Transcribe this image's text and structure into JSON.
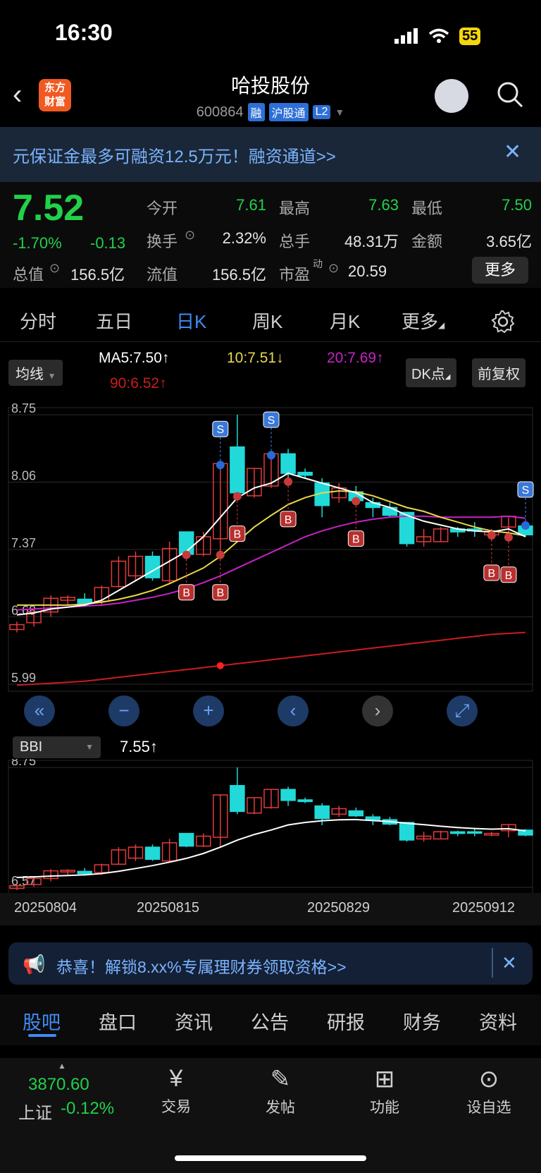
{
  "status": {
    "time": "16:30",
    "battery": "55"
  },
  "header": {
    "title": "哈投股份",
    "code": "600864",
    "tags": [
      "融",
      "沪股通",
      "L2"
    ],
    "logo": "东方财富"
  },
  "promo_top": {
    "text": "元保证金最多可融资12.5万元！融资通道>>"
  },
  "quote": {
    "price": "7.52",
    "change_pct": "-1.70%",
    "change": "-0.13",
    "open_label": "今开",
    "open": "7.61",
    "high_label": "最高",
    "high": "7.63",
    "low_label": "最低",
    "low": "7.50",
    "turnover_label": "换手",
    "turnover": "2.32%",
    "volume_label": "总手",
    "volume": "48.31万",
    "amount_label": "金额",
    "amount": "3.65亿",
    "mcap_label": "总值",
    "mcap": "156.5亿",
    "float_label": "流值",
    "float": "156.5亿",
    "pe_label": "市盈",
    "pe_sup": "动",
    "pe": "20.59",
    "more": "更多"
  },
  "tabs": [
    "分时",
    "五日",
    "日K",
    "周K",
    "月K",
    "更多"
  ],
  "ma": {
    "selector": "均线",
    "ma5": "MA5:7.50",
    "ma10": "10:7.51",
    "ma20": "20:7.69",
    "ma90": "90:6.52",
    "dk": "DK点",
    "fq": "前复权"
  },
  "bbi": {
    "selector": "BBI",
    "value": "7.55"
  },
  "promo_bottom": {
    "text": "恭喜！解锁8.xx%专属理财券领取资格>>"
  },
  "bottom_tabs": [
    "股吧",
    "盘口",
    "资讯",
    "公告",
    "研报",
    "财务",
    "资料"
  ],
  "footer": {
    "index_value": "3870.60",
    "index_name": "上证",
    "index_change": "-0.12%",
    "items": [
      {
        "label": "交易",
        "icon": "yen-icon"
      },
      {
        "label": "发帖",
        "icon": "edit-icon"
      },
      {
        "label": "功能",
        "icon": "grid-icon"
      },
      {
        "label": "设自选",
        "icon": "more-icon"
      }
    ]
  },
  "colors": {
    "up": "#e23b3b",
    "down": "#21d9d9",
    "ma5": "#ffffff",
    "ma10": "#e8d84a",
    "ma20": "#c623c6",
    "ma90": "#c81d1d",
    "accent": "#3e8cf5"
  },
  "chart_data": {
    "type": "candlestick",
    "x": [
      "20250804",
      "20250805",
      "20250806",
      "20250807",
      "20250808",
      "20250811",
      "20250812",
      "20250813",
      "20250814",
      "20250815",
      "20250818",
      "20250819",
      "20250820",
      "20250821",
      "20250822",
      "20250825",
      "20250826",
      "20250827",
      "20250828",
      "20250829",
      "20250901",
      "20250902",
      "20250903",
      "20250904",
      "20250905",
      "20250908",
      "20250909",
      "20250910",
      "20250911",
      "20250912",
      "20250915"
    ],
    "date_ticks": [
      "20250804",
      "20250815",
      "20250829",
      "20250912"
    ],
    "ohlc": [
      [
        6.55,
        6.63,
        6.52,
        6.6
      ],
      [
        6.62,
        6.76,
        6.58,
        6.73
      ],
      [
        6.73,
        6.9,
        6.68,
        6.87
      ],
      [
        6.85,
        6.9,
        6.8,
        6.88
      ],
      [
        6.86,
        6.92,
        6.78,
        6.82
      ],
      [
        6.84,
        7.0,
        6.8,
        6.98
      ],
      [
        6.99,
        7.3,
        6.98,
        7.25
      ],
      [
        7.1,
        7.35,
        7.05,
        7.3
      ],
      [
        7.3,
        7.35,
        7.05,
        7.08
      ],
      [
        7.05,
        7.45,
        7.02,
        7.38
      ],
      [
        7.55,
        7.55,
        7.3,
        7.32
      ],
      [
        7.32,
        7.55,
        7.3,
        7.5
      ],
      [
        7.48,
        8.25,
        7.3,
        8.25
      ],
      [
        8.42,
        8.75,
        7.9,
        7.95
      ],
      [
        7.92,
        8.2,
        7.9,
        8.2
      ],
      [
        8.02,
        8.35,
        8.0,
        8.35
      ],
      [
        8.35,
        8.4,
        8.05,
        8.15
      ],
      [
        8.16,
        8.2,
        8.1,
        8.13
      ],
      [
        8.05,
        8.1,
        7.7,
        7.82
      ],
      [
        7.9,
        8.05,
        7.85,
        8.0
      ],
      [
        7.96,
        8.02,
        7.85,
        7.87
      ],
      [
        7.85,
        7.9,
        7.7,
        7.8
      ],
      [
        7.8,
        7.85,
        7.7,
        7.72
      ],
      [
        7.75,
        7.75,
        7.4,
        7.43
      ],
      [
        7.45,
        7.58,
        7.4,
        7.5
      ],
      [
        7.45,
        7.6,
        7.45,
        7.58
      ],
      [
        7.58,
        7.6,
        7.5,
        7.55
      ],
      [
        7.58,
        7.65,
        7.5,
        7.56
      ],
      [
        7.52,
        7.58,
        7.5,
        7.55
      ],
      [
        7.6,
        7.7,
        7.48,
        7.71
      ],
      [
        7.61,
        7.63,
        7.5,
        7.52
      ]
    ],
    "ma5": [
      6.7,
      6.72,
      6.76,
      6.78,
      6.8,
      6.85,
      6.95,
      7.05,
      7.15,
      7.25,
      7.35,
      7.5,
      7.7,
      7.9,
      8.0,
      8.05,
      8.15,
      8.1,
      8.05,
      8.0,
      7.95,
      7.85,
      7.8,
      7.72,
      7.66,
      7.62,
      7.58,
      7.56,
      7.55,
      7.58,
      7.5
    ],
    "ma10": [
      6.8,
      6.8,
      6.8,
      6.8,
      6.81,
      6.83,
      6.86,
      6.9,
      6.95,
      7.02,
      7.1,
      7.18,
      7.3,
      7.45,
      7.6,
      7.72,
      7.83,
      7.9,
      7.95,
      7.97,
      7.96,
      7.92,
      7.86,
      7.8,
      7.76,
      7.7,
      7.65,
      7.6,
      7.56,
      7.54,
      7.51
    ],
    "ma20": [
      6.75,
      6.76,
      6.77,
      6.78,
      6.79,
      6.8,
      6.82,
      6.85,
      6.88,
      6.92,
      6.97,
      7.03,
      7.1,
      7.18,
      7.26,
      7.34,
      7.42,
      7.5,
      7.56,
      7.61,
      7.65,
      7.68,
      7.7,
      7.71,
      7.71,
      7.7,
      7.7,
      7.7,
      7.7,
      7.71,
      7.69
    ],
    "ma90": [
      5.98,
      5.99,
      6.0,
      6.01,
      6.02,
      6.04,
      6.06,
      6.08,
      6.1,
      6.12,
      6.14,
      6.16,
      6.18,
      6.2,
      6.22,
      6.24,
      6.26,
      6.28,
      6.3,
      6.32,
      6.34,
      6.36,
      6.38,
      6.4,
      6.42,
      6.44,
      6.46,
      6.48,
      6.5,
      6.51,
      6.52
    ],
    "ylim": [
      5.99,
      8.75
    ],
    "y_ticks": [
      "8.75",
      "8.06",
      "7.37",
      "6.68",
      "5.99"
    ],
    "bbi_ylim": [
      6.57,
      8.75
    ],
    "bbi_ticks": [
      "8.75",
      "6.57"
    ],
    "signals": [
      {
        "i": 12,
        "type": "B"
      },
      {
        "i": 10,
        "type": "B"
      },
      {
        "i": 13,
        "type": "B"
      },
      {
        "i": 16,
        "type": "B"
      },
      {
        "i": 20,
        "type": "B"
      },
      {
        "i": 28,
        "type": "B"
      },
      {
        "i": 29,
        "type": "B"
      },
      {
        "i": 12,
        "type": "S"
      },
      {
        "i": 15,
        "type": "S"
      },
      {
        "i": 30,
        "type": "S"
      }
    ]
  }
}
